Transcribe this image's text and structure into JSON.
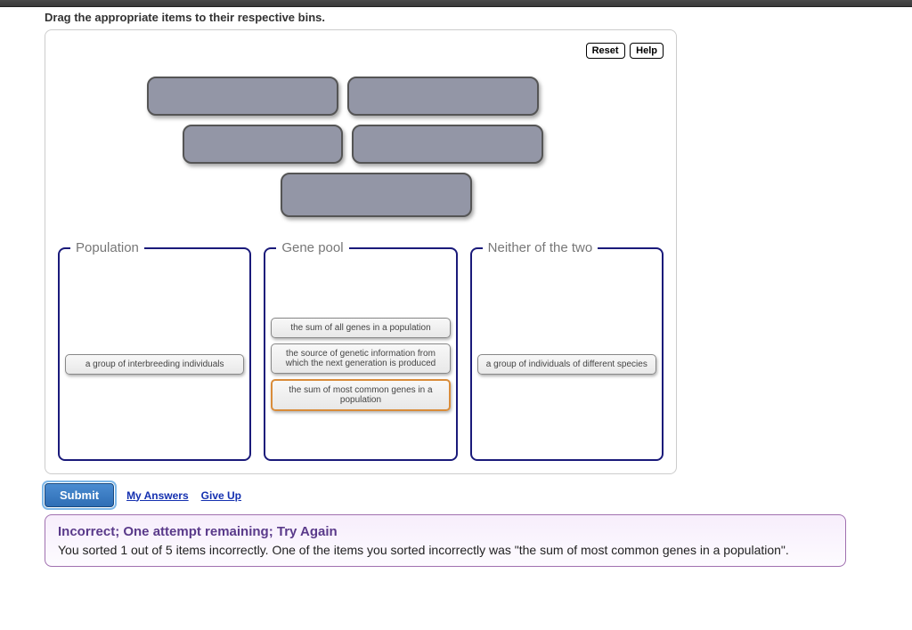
{
  "instruction": "Drag the appropriate items to their respective bins.",
  "buttons": {
    "reset": "Reset",
    "help": "Help"
  },
  "bins": {
    "population": {
      "title": "Population",
      "items": [
        "a group of interbreeding individuals"
      ]
    },
    "genepool": {
      "title": "Gene pool",
      "items": [
        "the sum of all genes in a population",
        "the source of genetic information from which the next generation is produced",
        "the sum of most common genes in a population"
      ],
      "wrong_index": 2
    },
    "neither": {
      "title": "Neither of the two",
      "items": [
        "a group of individuals of different species"
      ]
    }
  },
  "actions": {
    "submit": "Submit",
    "my_answers": "My Answers",
    "give_up": "Give Up"
  },
  "feedback": {
    "title": "Incorrect; One attempt remaining; Try Again",
    "body": "You sorted 1 out of 5 items incorrectly. One of the items you sorted incorrectly was \"the sum of most common genes in a population\"."
  }
}
